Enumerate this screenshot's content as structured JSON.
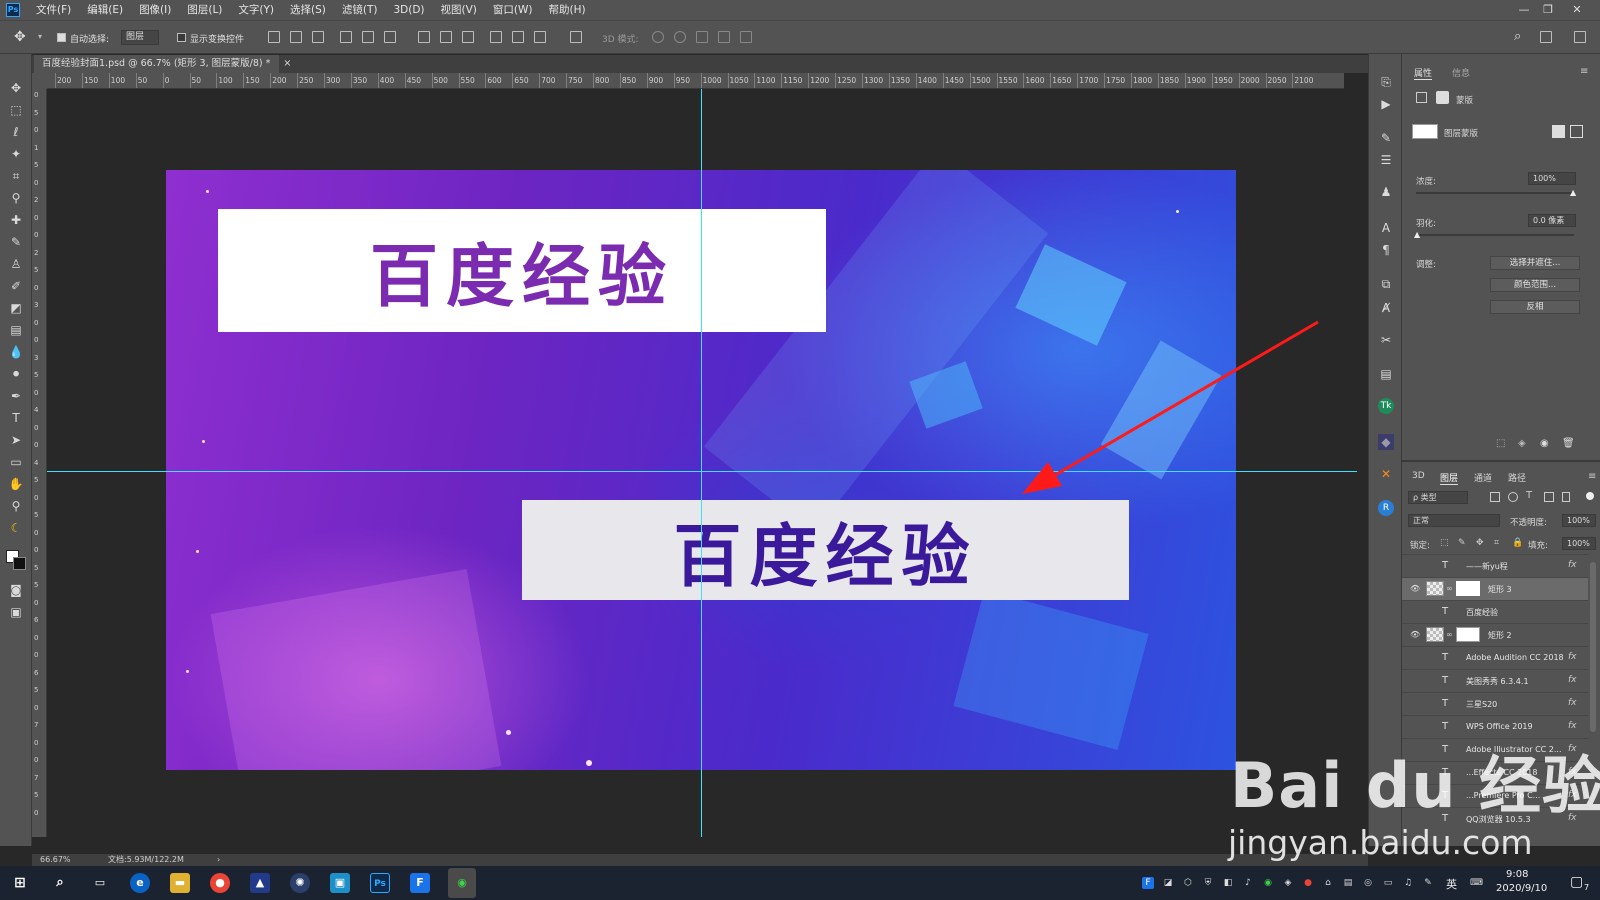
{
  "app": {
    "logo_text": "Ps",
    "title": ""
  },
  "menubar": {
    "items": [
      "文件(F)",
      "编辑(E)",
      "图像(I)",
      "图层(L)",
      "文字(Y)",
      "选择(S)",
      "滤镜(T)",
      "3D(D)",
      "视图(V)",
      "窗口(W)",
      "帮助(H)"
    ]
  },
  "options": {
    "auto_select_label": "自动选择:",
    "auto_select_value": "图层",
    "show_transform_label": "显示变换控件",
    "mode_3d_label": "3D 模式:"
  },
  "document": {
    "tab_label": "百度经验封面1.psd @ 66.7% (矩形 3, 图层蒙版/8) *",
    "tab_close": "×"
  },
  "ruler_top": [
    "200",
    "150",
    "100",
    "50",
    "0",
    "50",
    "100",
    "150",
    "200",
    "250",
    "300",
    "350",
    "400",
    "450",
    "500",
    "550",
    "600",
    "650",
    "700",
    "750",
    "800",
    "850",
    "900",
    "950",
    "1000",
    "1050",
    "1100",
    "1150",
    "1200",
    "1250",
    "1300",
    "1350",
    "1400",
    "1450",
    "1500",
    "1550",
    "1600",
    "1650",
    "1700",
    "1750",
    "1800",
    "1850",
    "1900",
    "1950",
    "2000",
    "2050",
    "2100"
  ],
  "ruler_left": [
    "0",
    "5",
    "0",
    "1",
    "5",
    "0",
    "2",
    "0",
    "0",
    "2",
    "5",
    "0",
    "3",
    "0",
    "0",
    "3",
    "5",
    "0",
    "4",
    "0",
    "0",
    "4",
    "5",
    "0",
    "5",
    "0",
    "0",
    "5",
    "5",
    "0",
    "6",
    "0",
    "0",
    "6",
    "5",
    "0",
    "7",
    "0",
    "0",
    "7",
    "5",
    "0"
  ],
  "canvas": {
    "banner_top_text": "百度经验",
    "banner_bottom_text": "百度经验",
    "guide_color": "#3fe0ff",
    "arrow_color": "#ff1a1a"
  },
  "status": {
    "zoom": "66.67%",
    "doc_size": "文档:5.93M/122.2M",
    "arrow": "›"
  },
  "properties": {
    "tab_properties": "属性",
    "tab_info": "信息",
    "mask_type_label": "蒙版",
    "layer_mask_label": "图层蒙版",
    "density_label": "浓度:",
    "density_value": "100%",
    "feather_label": "羽化:",
    "feather_value": "0.0 像素",
    "adjust_label": "调整:",
    "select_mask_btn": "选择并遮住...",
    "color_range_btn": "颜色范围...",
    "invert_btn": "反相"
  },
  "layers_panel": {
    "tabs": [
      "3D",
      "图层",
      "通道",
      "路径"
    ],
    "filter_label": "ρ 类型",
    "blend_mode": "正常",
    "opacity_label": "不透明度:",
    "opacity_value": "100%",
    "lock_label": "锁定:",
    "fill_label": "填充:",
    "fill_value": "100%",
    "rows": [
      {
        "name": "——新yu程",
        "type": "text",
        "fx": "fx"
      },
      {
        "name": "矩形 3",
        "type": "shape",
        "fx": "",
        "visible": "true"
      },
      {
        "name": "百度经验",
        "type": "text",
        "fx": ""
      },
      {
        "name": "矩形 2",
        "type": "shape",
        "fx": "",
        "visible": "true"
      },
      {
        "name": "Adobe Audition CC 2018",
        "type": "text",
        "fx": "fx"
      },
      {
        "name": "美图秀秀 6.3.4.1",
        "type": "text",
        "fx": "fx"
      },
      {
        "name": "三星S20",
        "type": "text",
        "fx": "fx"
      },
      {
        "name": "WPS Office 2019",
        "type": "text",
        "fx": "fx"
      },
      {
        "name": "Adobe Illustrator CC 2...",
        "type": "text",
        "fx": "fx"
      },
      {
        "name": "...Effects CC 2018",
        "type": "text",
        "fx": "fx"
      },
      {
        "name": "...Premiere Pro C...",
        "type": "text",
        "fx": "fx"
      },
      {
        "name": "QQ浏览器 10.5.3",
        "type": "text",
        "fx": "fx"
      }
    ]
  },
  "taskbar": {
    "time": "9:08",
    "date": "2020/9/10",
    "ime": "英",
    "notif_count": "7"
  },
  "watermark": {
    "logo": "Bai du 经验",
    "url": "jingyan.baidu.com"
  }
}
